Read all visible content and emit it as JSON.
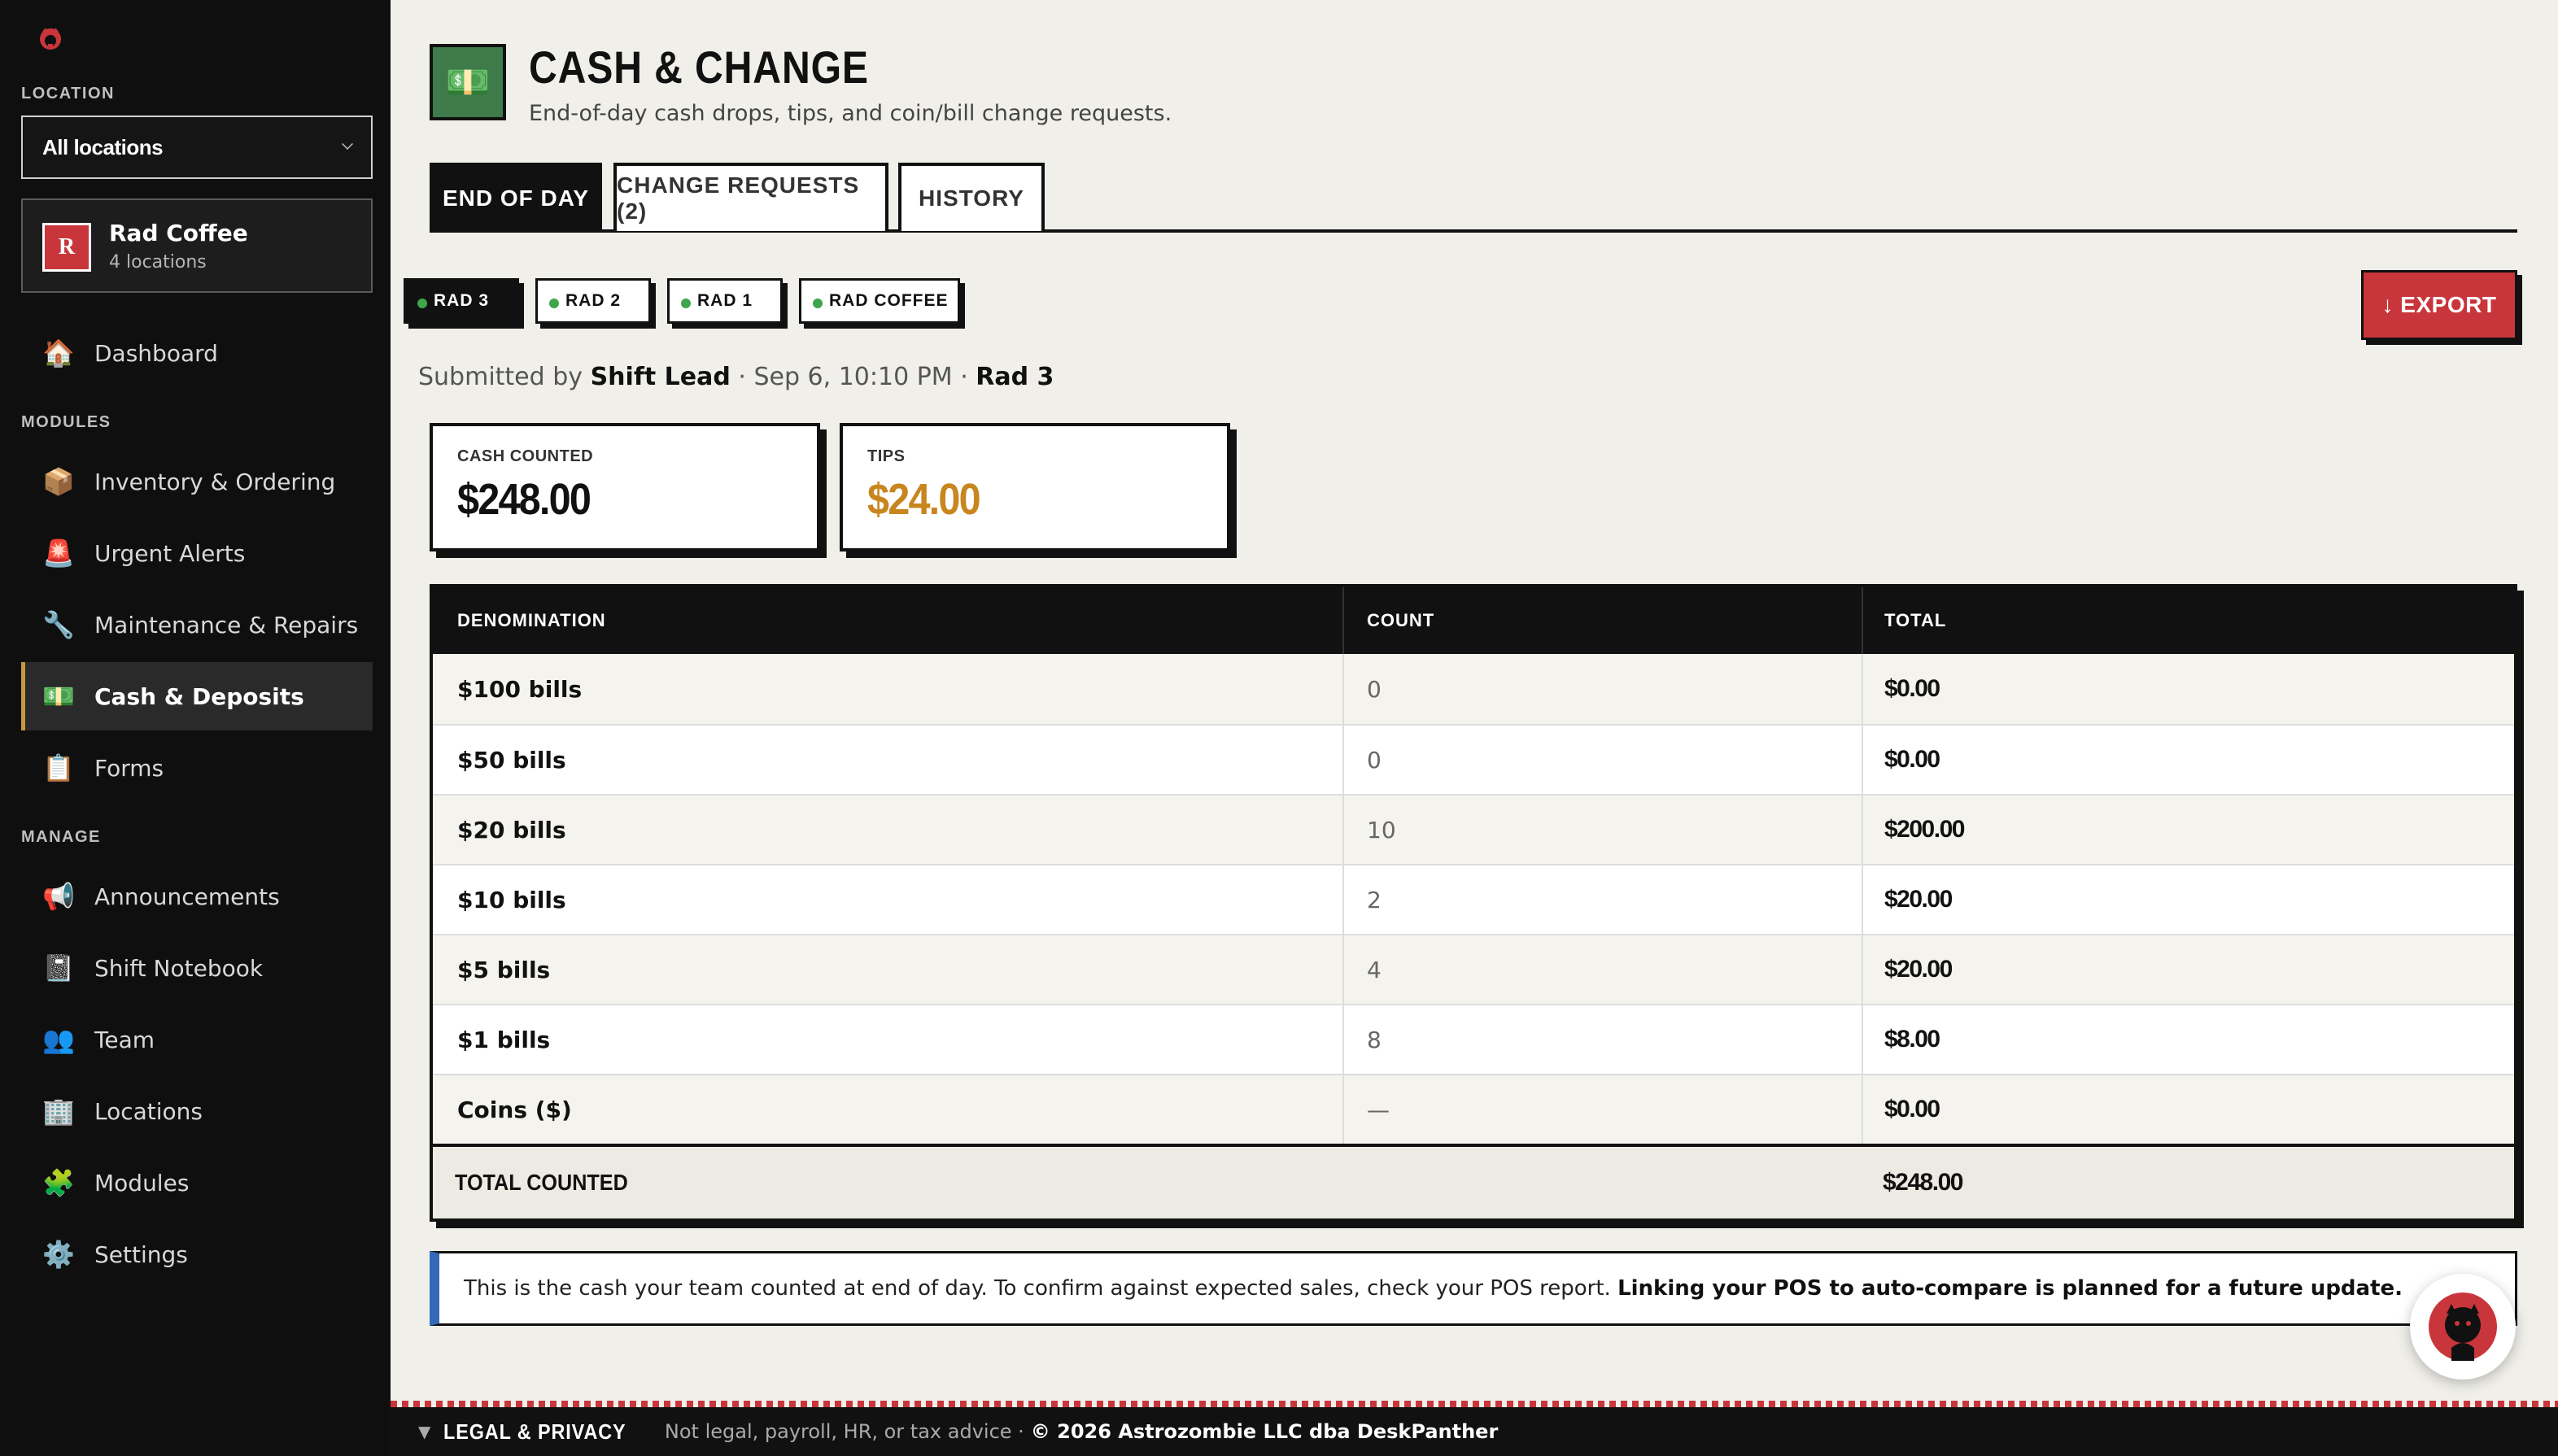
{
  "sidebar": {
    "location_label": "LOCATION",
    "location_select": "All locations",
    "org": {
      "initial": "R",
      "name": "Rad Coffee",
      "sub": "4 locations"
    },
    "dashboard": {
      "icon": "🏠",
      "label": "Dashboard"
    },
    "modules_label": "MODULES",
    "modules": [
      {
        "icon": "📦",
        "label": "Inventory & Ordering"
      },
      {
        "icon": "🚨",
        "label": "Urgent Alerts"
      },
      {
        "icon": "🔧",
        "label": "Maintenance & Repairs"
      },
      {
        "icon": "💵",
        "label": "Cash & Deposits"
      },
      {
        "icon": "📋",
        "label": "Forms"
      }
    ],
    "manage_label": "MANAGE",
    "manage": [
      {
        "icon": "📢",
        "label": "Announcements"
      },
      {
        "icon": "📓",
        "label": "Shift Notebook"
      },
      {
        "icon": "👥",
        "label": "Team"
      },
      {
        "icon": "🏢",
        "label": "Locations"
      },
      {
        "icon": "🧩",
        "label": "Modules"
      },
      {
        "icon": "⚙️",
        "label": "Settings"
      }
    ]
  },
  "header": {
    "icon": "💵",
    "title": "CASH & CHANGE",
    "subtitle": "End-of-day cash drops, tips, and coin/bill change requests."
  },
  "tabs": [
    "END OF DAY",
    "CHANGE REQUESTS (2)",
    "HISTORY"
  ],
  "location_chips": [
    "RAD 3",
    "RAD 2",
    "RAD 1",
    "RAD COFFEE"
  ],
  "export_label": "↓ EXPORT",
  "submission": {
    "prefix": "Submitted by",
    "by": "Shift Lead",
    "when": "· Sep 6, 10:10 PM ·",
    "location": "Rad 3"
  },
  "stats": {
    "cash_label": "CASH COUNTED",
    "cash_value": "$248.00",
    "tips_label": "TIPS",
    "tips_value": "$24.00",
    "tips_color": "#c8861f"
  },
  "table": {
    "headers": [
      "DENOMINATION",
      "COUNT",
      "TOTAL"
    ],
    "rows": [
      {
        "denom": "$100 bills",
        "count": "0",
        "total": "$0.00"
      },
      {
        "denom": "$50 bills",
        "count": "0",
        "total": "$0.00"
      },
      {
        "denom": "$20 bills",
        "count": "10",
        "total": "$200.00"
      },
      {
        "denom": "$10 bills",
        "count": "2",
        "total": "$20.00"
      },
      {
        "denom": "$5 bills",
        "count": "4",
        "total": "$20.00"
      },
      {
        "denom": "$1 bills",
        "count": "8",
        "total": "$8.00"
      },
      {
        "denom": "Coins ($)",
        "count": "—",
        "total": "$0.00"
      }
    ],
    "total_label": "TOTAL COUNTED",
    "total_value": "$248.00"
  },
  "note": {
    "text": "This is the cash your team counted at end of day. To confirm against expected sales, check your POS report.",
    "bold": "Linking your POS to auto-compare is planned for a future update."
  },
  "footer": {
    "caret": "▼",
    "legal": "LEGAL & PRIVACY",
    "disclaimer": "Not legal, payroll, HR, or tax advice ·",
    "copyright": "© 2026 Astrozombie LLC dba DeskPanther"
  },
  "colors": {
    "accent_red": "#c8363b",
    "accent_gold": "#c8963b",
    "status_green": "#3ea64a",
    "note_blue": "#3569b8"
  }
}
